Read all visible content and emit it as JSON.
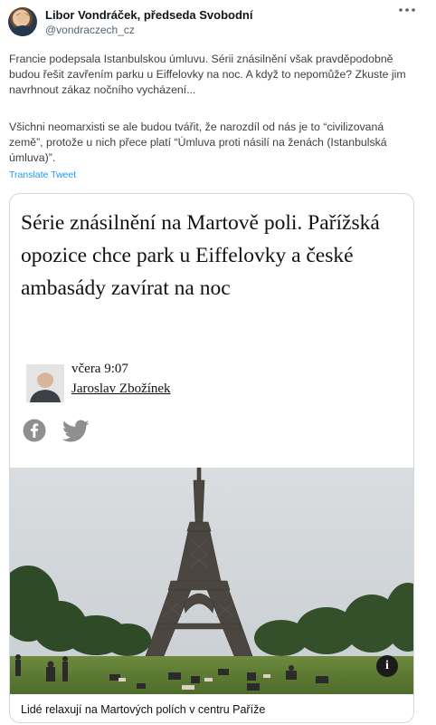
{
  "tweet": {
    "author_name": "Libor Vondráček, předseda Svobodní",
    "author_handle": "@vondraczech_cz",
    "more_icon": "more-dots-icon",
    "paragraph1": "Francie podepsala Istanbulskou úmluvu. Sérii znásilnění však pravděpodobně budou řešit zavřením parku u Eiffelovky na noc. A když to nepomůže? Zkuste jim navrhnout zákaz nočního vycházení...",
    "paragraph2": "Všichni neomarxisti se ale budou tvářit, že narozdíl od nás je to “civilizovaná země”, protože u nich přece platí “Úmluva proti násilí na ženách (Istanbulská úmluva)”.",
    "translate_label": "Translate Tweet"
  },
  "article": {
    "headline": "Série znásilnění na Martově poli. Pařížská opozice chce park u Eiffelovky a české ambasády zavírat na noc",
    "date": "včera 9:07",
    "author": "Jaroslav Zbožínek",
    "share_icons": [
      "facebook-icon",
      "twitter-icon"
    ],
    "info_label": "i",
    "photo_caption": "Lidé relaxují na Martových polích v centru Paříže"
  }
}
